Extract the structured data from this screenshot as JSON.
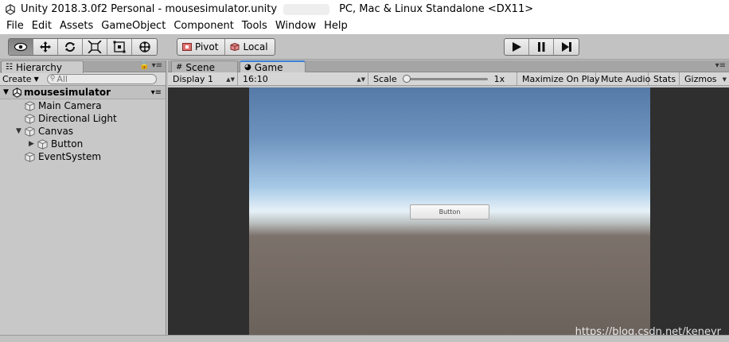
{
  "window": {
    "title": "Unity 2018.3.0f2 Personal - mousesimulator.unity",
    "platform": "PC, Mac & Linux Standalone <DX11>"
  },
  "menu": [
    "File",
    "Edit",
    "Assets",
    "GameObject",
    "Component",
    "Tools",
    "Window",
    "Help"
  ],
  "toolbar": {
    "tools": [
      "view-tool",
      "move-tool",
      "rotate-tool",
      "scale-tool",
      "rect-tool",
      "transform-tool"
    ],
    "pivot_label": "Pivot",
    "local_label": "Local",
    "play_controls": [
      "play",
      "pause",
      "step"
    ]
  },
  "hierarchy": {
    "tab_label": "Hierarchy",
    "create_label": "Create",
    "search_placeholder": "All",
    "scene_name": "mousesimulator",
    "items": [
      {
        "name": "Main Camera",
        "depth": 1,
        "expandable": false
      },
      {
        "name": "Directional Light",
        "depth": 1,
        "expandable": false
      },
      {
        "name": "Canvas",
        "depth": 1,
        "expandable": true,
        "expanded": true
      },
      {
        "name": "Button",
        "depth": 2,
        "expandable": true,
        "expanded": false
      },
      {
        "name": "EventSystem",
        "depth": 1,
        "expandable": false
      }
    ]
  },
  "game_view": {
    "tabs": [
      {
        "label": "Scene",
        "active": false
      },
      {
        "label": "Game",
        "active": true
      }
    ],
    "display": "Display 1",
    "aspect": "16:10",
    "scale_label": "Scale",
    "scale_value": "1x",
    "maximize_on_play": "Maximize On Play",
    "mute_audio": "Mute Audio",
    "stats": "Stats",
    "gizmos": "Gizmos",
    "button_text": "Button"
  },
  "watermark": "https://blog.csdn.net/keneyr",
  "colors": {
    "sky_top": "#567aa7",
    "horizon": "#e6f1f7",
    "ground": "#6c625c",
    "panel": "#c2c2c2"
  }
}
